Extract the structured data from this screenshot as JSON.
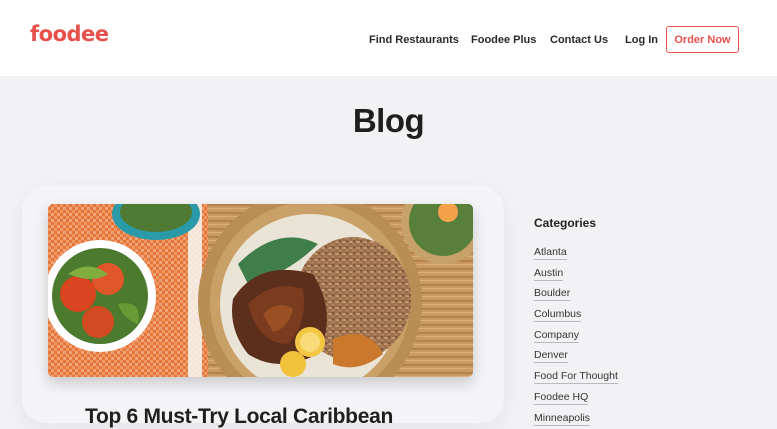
{
  "brand": {
    "logo": "foodee",
    "color": "#e8504b"
  },
  "nav": {
    "items": [
      {
        "label": "Find Restaurants"
      },
      {
        "label": "Foodee Plus"
      },
      {
        "label": "Contact Us"
      },
      {
        "label": "Log In"
      }
    ],
    "cta_label": "Order Now"
  },
  "page": {
    "title": "Blog"
  },
  "featured_post": {
    "title": "Top 6 Must-Try Local Caribbean",
    "image_icon": "jerk-chicken-plate-image"
  },
  "sidebar": {
    "categories_heading": "Categories",
    "categories": [
      "Atlanta",
      "Austin",
      "Boulder",
      "Columbus",
      "Company",
      "Denver",
      "Food For Thought",
      "Foodee HQ",
      "Minneapolis"
    ]
  }
}
